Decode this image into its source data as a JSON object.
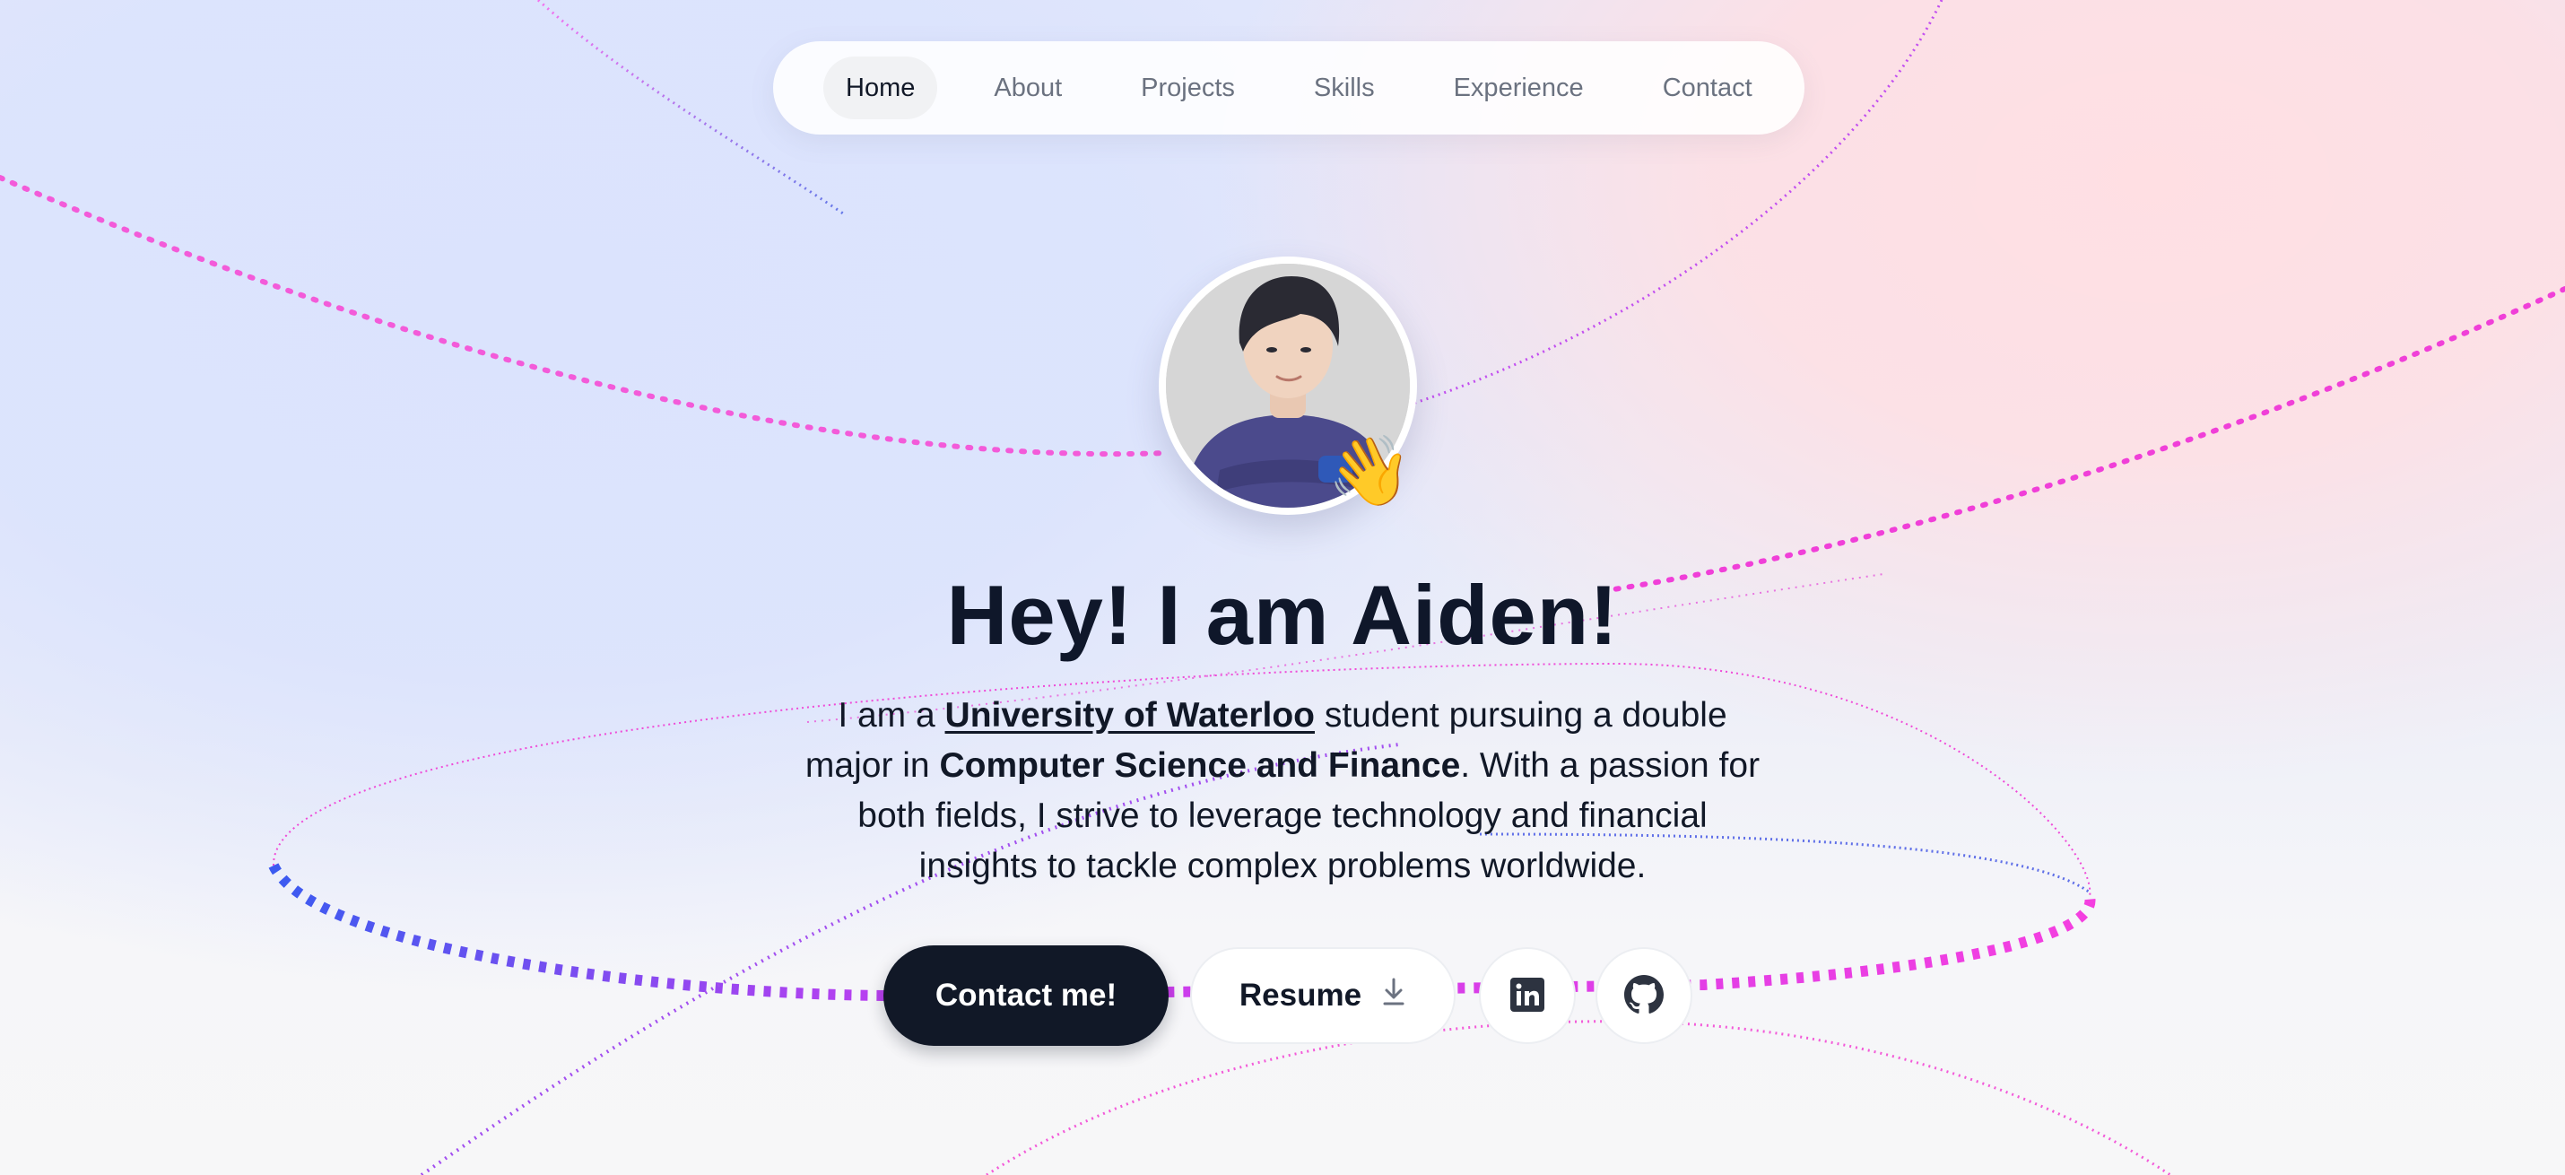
{
  "nav": {
    "items": [
      {
        "label": "Home",
        "active": true
      },
      {
        "label": "About",
        "active": false
      },
      {
        "label": "Projects",
        "active": false
      },
      {
        "label": "Skills",
        "active": false
      },
      {
        "label": "Experience",
        "active": false
      },
      {
        "label": "Contact",
        "active": false
      }
    ]
  },
  "hero": {
    "wave_emoji": "👋",
    "headline": "Hey! I am Aiden!",
    "intro": {
      "part1": "I am a ",
      "university": "University of Waterloo",
      "part2": " student pursuing a double major in ",
      "major": "Computer Science and Finance",
      "part3": ". With a passion for both fields, I strive to leverage technology and financial insights to tackle complex problems worldwide."
    }
  },
  "actions": {
    "contact_label": "Contact me!",
    "resume_label": "Resume",
    "resume_icon": "download-icon",
    "linkedin_icon": "linkedin-icon",
    "github_icon": "github-icon"
  },
  "colors": {
    "primary_button": "#111827",
    "swirl_pink": "#f43fe0",
    "swirl_blue": "#3b5bf0"
  }
}
